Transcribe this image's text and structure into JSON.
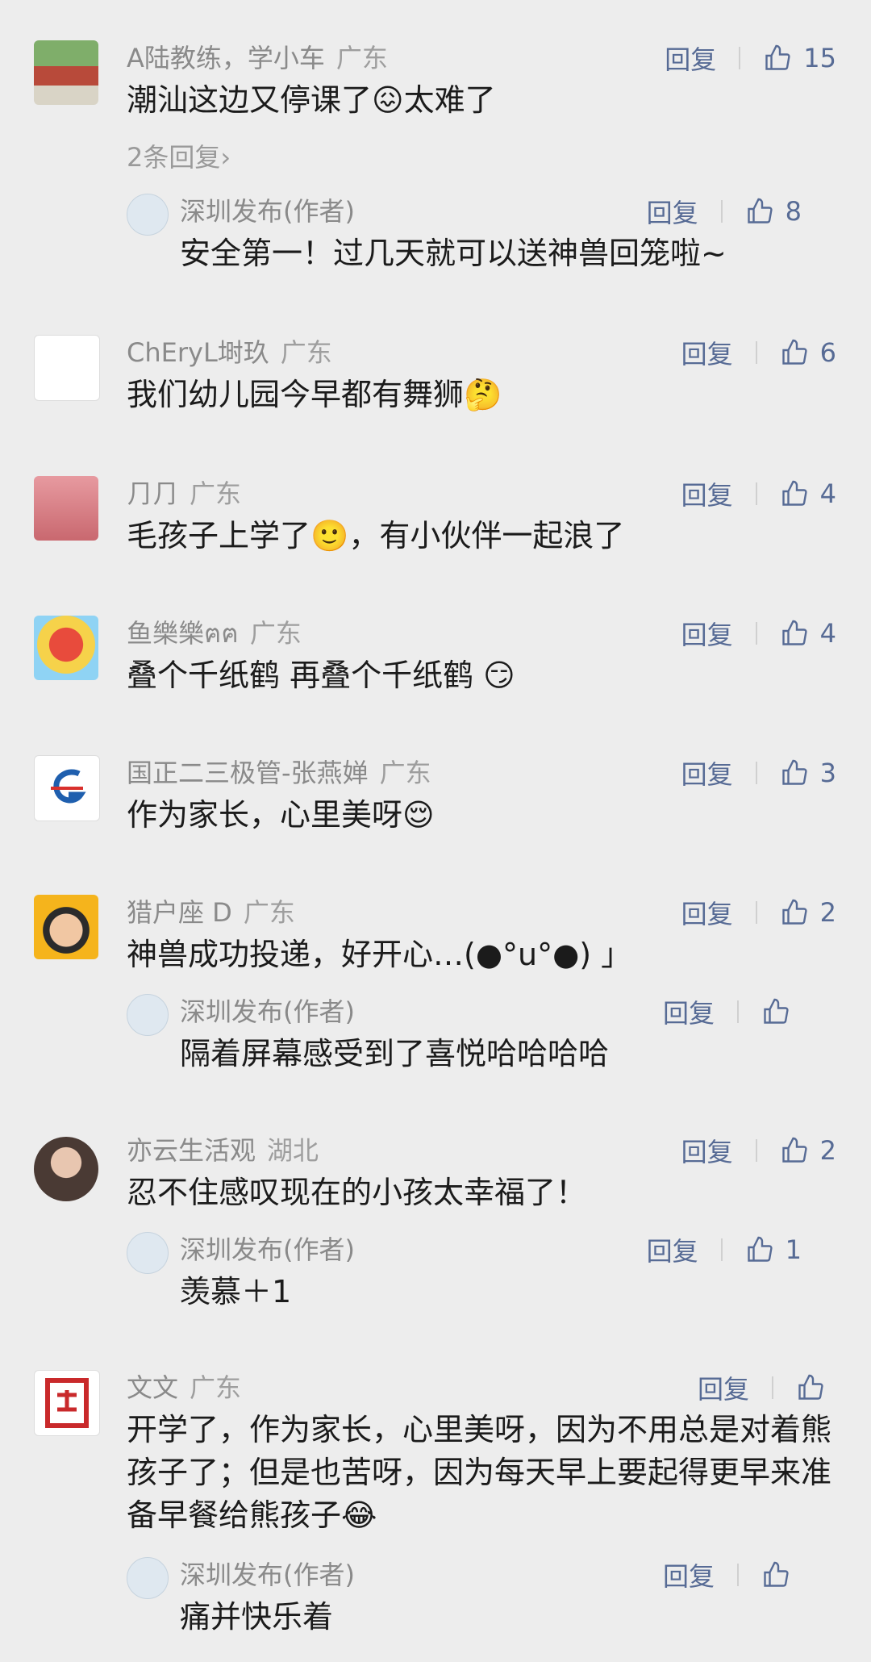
{
  "colors": {
    "background": "#ededed",
    "link": "#576b95",
    "meta": "#8a8a8a",
    "text": "#1b1b1b"
  },
  "comments": [
    {
      "name": "A陆教练，学小车",
      "loc": "广东",
      "text": "潮汕这边又停课了😖太难了",
      "reply_label": "回复",
      "likes": "15",
      "more": "2条回复›",
      "sub": {
        "name": "深圳发布(作者)",
        "text": "安全第一！过几天就可以送神兽回笼啦~",
        "reply_label": "回复",
        "likes": "8"
      }
    },
    {
      "name": "ChEryL埘玖",
      "loc": "广东",
      "text": "我们幼儿园今早都有舞狮🤔",
      "reply_label": "回复",
      "likes": "6"
    },
    {
      "name": "⺆⺆",
      "loc": "广东",
      "text": "毛孩子上学了🙂，有小伙伴一起浪了",
      "reply_label": "回复",
      "likes": "4"
    },
    {
      "name": "鱼樂樂ฅฅ",
      "loc": "广东",
      "text": "叠个千纸鹤 再叠个千纸鹤 😏",
      "reply_label": "回复",
      "likes": "4"
    },
    {
      "name": "国正二三极管-张燕婵",
      "loc": "广东",
      "text": "作为家长，心里美呀😌",
      "reply_label": "回复",
      "likes": "3"
    },
    {
      "name": "猎户座 D",
      "loc": "广东",
      "text": "神兽成功投递，好开心…(●°u°●) 」",
      "reply_label": "回复",
      "likes": "2",
      "sub": {
        "name": "深圳发布(作者)",
        "text": "隔着屏幕感受到了喜悦哈哈哈哈",
        "reply_label": "回复",
        "likes": ""
      }
    },
    {
      "name": "亦云生活观",
      "loc": "湖北",
      "text": "忍不住感叹现在的小孩太幸福了！",
      "reply_label": "回复",
      "likes": "2",
      "sub": {
        "name": "深圳发布(作者)",
        "text": "羡慕＋1",
        "reply_label": "回复",
        "likes": "1"
      }
    },
    {
      "name": "文文",
      "loc": "广东",
      "text": "开学了，作为家长，心里美呀，因为不用总是对着熊孩子了；但是也苦呀，因为每天早上要起得更早来准备早餐给熊孩子😂",
      "reply_label": "回复",
      "likes": "",
      "sub": {
        "name": "深圳发布(作者)",
        "text": "痛并快乐着",
        "reply_label": "回复",
        "likes": ""
      }
    }
  ]
}
